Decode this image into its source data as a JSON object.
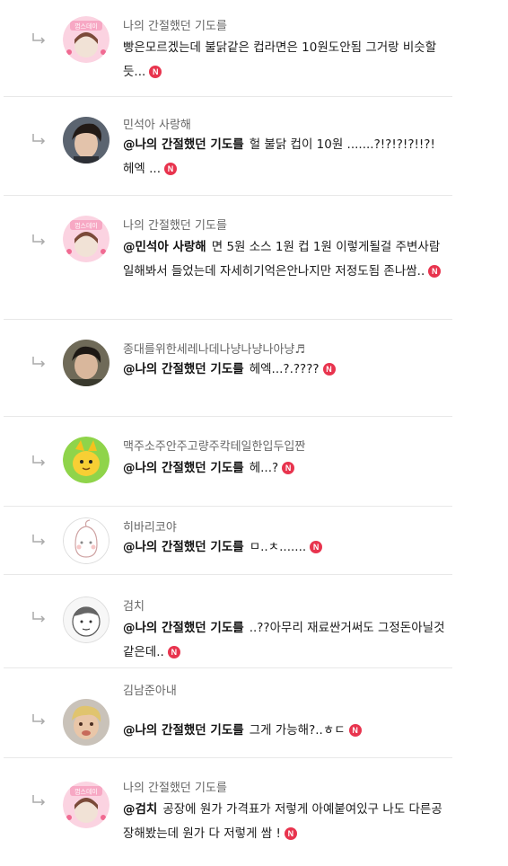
{
  "comments": [
    {
      "nickname": "나의 간절했던 기도를",
      "mention": "",
      "text": "빵은모르겠는데 불닭같은 컵라면은 10원도안됨 그거랑 비슷할듯...",
      "new": true,
      "avatar": "pink-sticker-avatar"
    },
    {
      "nickname": "민석아 사랑해",
      "mention": "@나의 간절했던 기도를",
      "text": "헐 불닭 컵이 10원 .......?!?!?!?!!?! 헤엑 ...",
      "new": true,
      "avatar": "male-photo-avatar"
    },
    {
      "nickname": "나의 간절했던 기도를",
      "mention": "@민석아 사랑해",
      "text": "면 5원 소스 1원 컵 1원 이렇게될걸 주변사람일해봐서 들었는데 자세히기억은안나지만 저정도됨 존나쌈..",
      "new": true,
      "avatar": "pink-sticker-avatar"
    },
    {
      "nickname": "종대를위한세레나데나냥나냥나아냥♬",
      "mention": "@나의 간절했던 기도를",
      "text": "헤엑...?.????",
      "new": true,
      "avatar": "male-photo-avatar"
    },
    {
      "nickname": "맥주소주안주고량주칵테일한입두입짠",
      "mention": "@나의 간절했던 기도를",
      "text": "헤...?",
      "new": true,
      "avatar": "cartoon-avatar"
    },
    {
      "nickname": "히바리코야",
      "mention": "@나의 간절했던 기도를",
      "text": "ㅁ..ㅊ.......",
      "new": true,
      "avatar": "peach-sketch-avatar"
    },
    {
      "nickname": "검치",
      "mention": "@나의 간절했던 기도를",
      "text": "..??아무리 재료싼거써도 그정돈아닐것같은데..",
      "new": true,
      "avatar": "sketch-avatar"
    },
    {
      "nickname": "김남준아내",
      "mention": "@나의 간절했던 기도를",
      "text": "그게 가능해?..ㅎㄷ",
      "new": true,
      "avatar": "blonde-photo-avatar"
    },
    {
      "nickname": "나의 간절했던 기도를",
      "mention": "@검치",
      "text": "공장에 원가 가격표가 저렇게 아예붙여있구 나도 다른공장해봤는데 원가 다 저렇게 쌈 !",
      "new": true,
      "avatar": "pink-sticker-avatar"
    }
  ],
  "badge_label": "N",
  "sticker_label": "껌스데이",
  "colors": {
    "badge": "#e8344e",
    "divider": "#e8e8e8",
    "nickname": "#666666"
  }
}
